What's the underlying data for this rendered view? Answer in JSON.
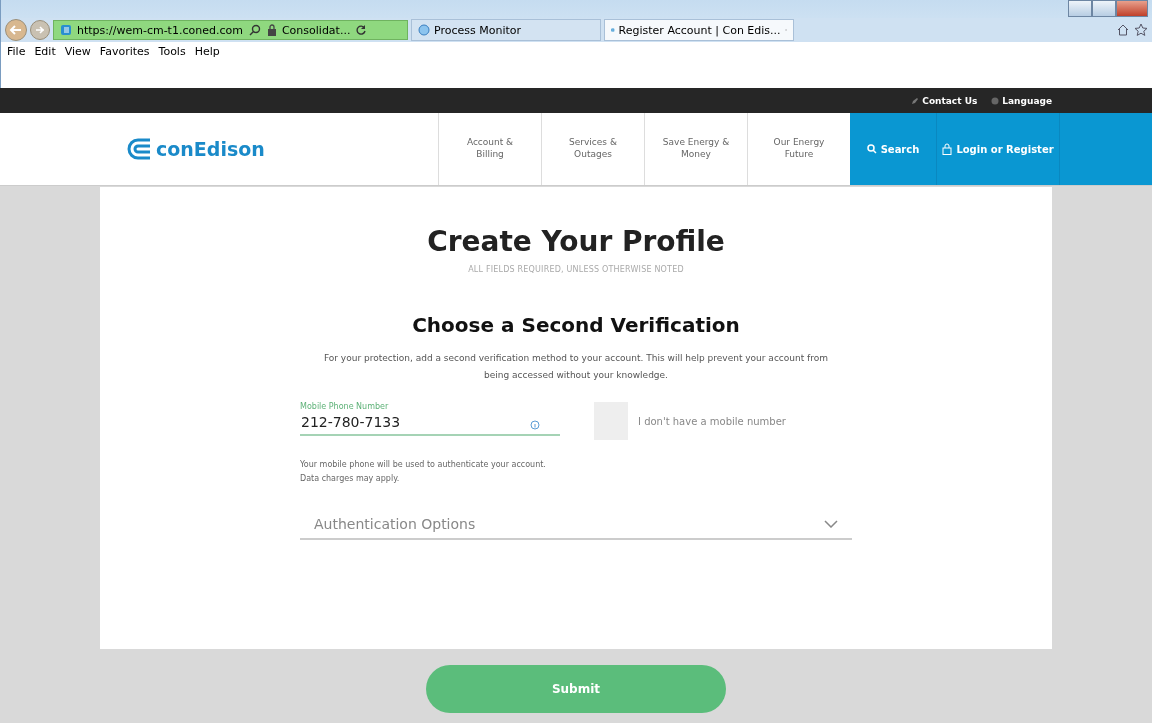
{
  "browser": {
    "url_host": "https://wem-cm-t1.coned.com",
    "site_label": "Consolidat...",
    "tabs": [
      {
        "title": "Process Monitor",
        "selected": false
      },
      {
        "title": "Register Account | Con Edis...",
        "selected": true
      }
    ],
    "menu": [
      "File",
      "Edit",
      "View",
      "Favorites",
      "Tools",
      "Help"
    ]
  },
  "utility_links": [
    "Contact Us",
    "Language"
  ],
  "logo": "conEdison",
  "nav": [
    {
      "label": "Account &\nBilling",
      "kind": "link"
    },
    {
      "label": "Services &\nOutages",
      "kind": "link"
    },
    {
      "label": "Save Energy &\nMoney",
      "kind": "link"
    },
    {
      "label": "Our Energy\nFuture",
      "kind": "link"
    },
    {
      "label": "Search",
      "kind": "search"
    },
    {
      "label": "Login or Register",
      "kind": "login"
    }
  ],
  "form": {
    "title": "Create Your Profile",
    "subtitle": "ALL FIELDS REQUIRED, UNLESS OTHERWISE NOTED",
    "section_title": "Choose a Second Verification",
    "description": "For your protection, add a second verification method to your account. This will help prevent your account from being accessed without your knowledge.",
    "phone": {
      "label": "Mobile Phone Number",
      "value": "212-780-7133"
    },
    "no_mobile": {
      "label": "I don't have a mobile number",
      "checked": false
    },
    "phone_help": "Your mobile phone will be used to authenticate your account. Data charges may apply.",
    "auth_options": {
      "placeholder": "Authentication Options"
    },
    "submit": "Submit"
  }
}
